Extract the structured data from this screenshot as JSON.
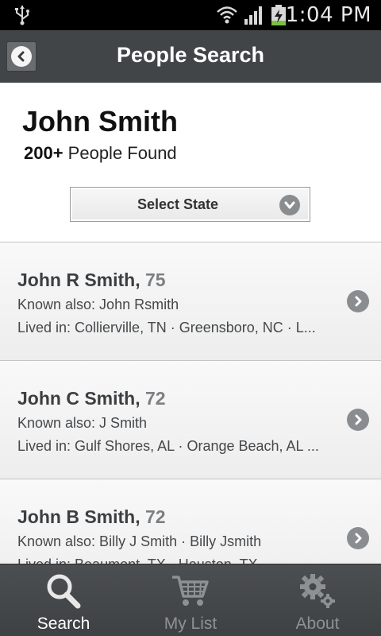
{
  "status_bar": {
    "time": "1:04 PM",
    "icons": [
      "usb-icon",
      "wifi-icon",
      "signal-icon",
      "battery-charging-icon"
    ]
  },
  "header": {
    "title": "People Search",
    "back_icon": "back-arrow-icon"
  },
  "summary": {
    "query_name": "John Smith",
    "found_count": "200+",
    "found_suffix": " People Found",
    "state_select_label": "Select State"
  },
  "results": [
    {
      "name": "John R Smith,",
      "age": "75",
      "known_also": "Known also: John Rsmith",
      "lived_in": "Lived in: Collierville, TN · Greensboro, NC · L..."
    },
    {
      "name": "John C Smith,",
      "age": "72",
      "known_also": "Known also: J Smith",
      "lived_in": "Lived in: Gulf Shores, AL · Orange Beach, AL ..."
    },
    {
      "name": "John B Smith,",
      "age": "72",
      "known_also": "Known also: Billy J Smith · Billy Jsmith",
      "lived_in": "Lived in: Beaumont, TX · Houston, TX"
    }
  ],
  "tabs": [
    {
      "label": "Search",
      "icon": "search-icon",
      "active": true
    },
    {
      "label": "My List",
      "icon": "cart-icon",
      "active": false
    },
    {
      "label": "About",
      "icon": "gears-icon",
      "active": false
    }
  ],
  "colors": {
    "header_bg": "#424547",
    "tab_bar_bg": "#3e4143",
    "row_bg": "#f2f2f2",
    "accent_gray": "#8a8d90"
  }
}
